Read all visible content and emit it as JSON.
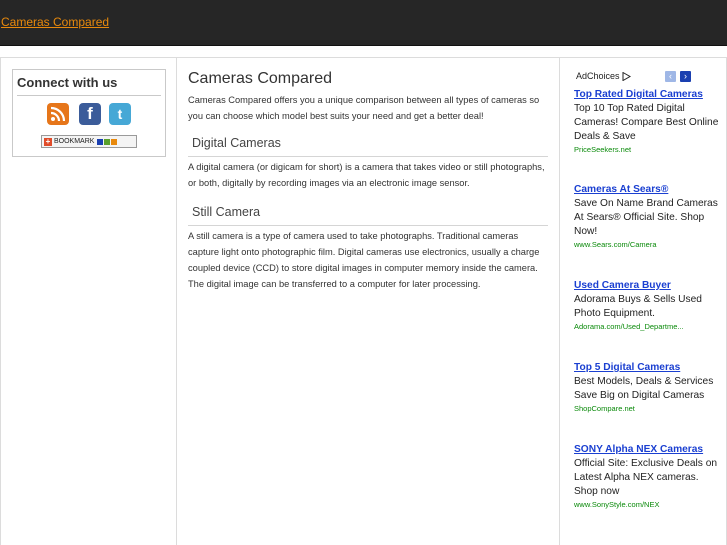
{
  "header": {
    "site_link": "Cameras Compared"
  },
  "sidebar": {
    "connect_title": "Connect with us",
    "bookmark_label": "BOOKMARK"
  },
  "main": {
    "title": "Cameras Compared",
    "intro": "Cameras Compared offers you a unique comparison between all types of cameras so you can choose which model best suits your need and get a better deal!",
    "sections": [
      {
        "heading": "Digital Cameras",
        "body": "A digital camera (or digicam for short) is a camera that takes video or still photographs, or both, digitally by recording images via an electronic image sensor."
      },
      {
        "heading": "Still Camera",
        "body": "A still camera is a type of camera used to take photographs. Traditional cameras capture light onto photographic film. Digital cameras use electronics, usually a charge coupled device (CCD) to store digital images in computer memory inside the camera. The digital image can be transferred to a computer for later processing."
      }
    ]
  },
  "ads": {
    "adchoices_label": "AdChoices",
    "prev_glyph": "‹",
    "next_glyph": "›",
    "items": [
      {
        "title": "Top Rated Digital Cameras",
        "desc": "Top 10 Top Rated Digital Cameras! Compare Best Online Deals & Save",
        "url": "PriceSeekers.net"
      },
      {
        "title": "Cameras At Sears®",
        "desc": "Save On Name Brand Cameras At Sears® Official Site. Shop Now!",
        "url": "www.Sears.com/Camera"
      },
      {
        "title": "Used Camera Buyer",
        "desc": "Adorama Buys & Sells Used Photo Equipment.",
        "url": "Adorama.com/Used_Departme..."
      },
      {
        "title": "Top 5 Digital Cameras",
        "desc": "Best Models, Deals & Services Save Big on Digital Cameras",
        "url": "ShopCompare.net"
      },
      {
        "title": "SONY Alpha NEX Cameras",
        "desc": "Official Site: Exclusive Deals on Latest Alpha NEX cameras. Shop now",
        "url": "www.SonyStyle.com/NEX"
      }
    ]
  },
  "icons": {
    "rss": "rss-icon",
    "facebook": "facebook-icon",
    "twitter": "twitter-icon"
  }
}
